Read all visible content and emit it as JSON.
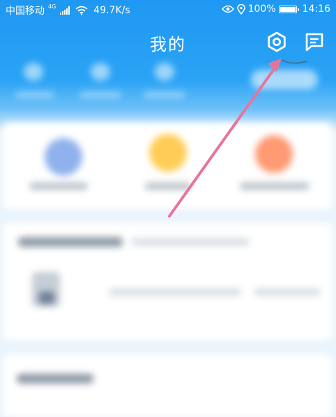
{
  "status_bar": {
    "carrier": "中国移动",
    "network_type": "4G",
    "speed": "49.7K/s",
    "battery": "100%",
    "time": "14:16"
  },
  "header": {
    "title": "我的"
  },
  "colors": {
    "header_blue": "#1e98f2",
    "annotation_arrow": "#e8749a",
    "card_white": "#ffffff"
  },
  "icons": {
    "settings": "gear-icon",
    "messages": "message-icon"
  }
}
